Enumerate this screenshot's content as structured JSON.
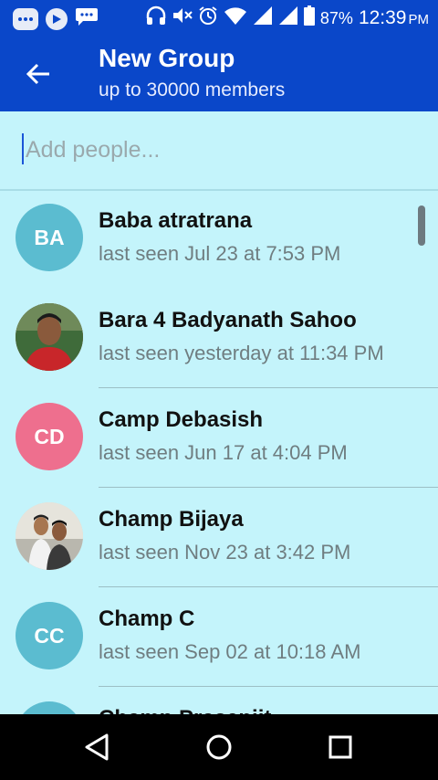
{
  "status_bar": {
    "battery_percent": "87%",
    "time": "12:39",
    "ampm": "PM",
    "icons": [
      "messages-icon",
      "play-icon",
      "chat-icon",
      "headphones-icon",
      "mute-icon",
      "alarm-icon",
      "wifi-icon",
      "signal-icon",
      "signal-icon",
      "battery-icon"
    ]
  },
  "app_bar": {
    "title": "New Group",
    "subtitle": "up to 30000 members",
    "back_icon": "arrow-back-icon"
  },
  "search": {
    "placeholder": "Add people...",
    "value": ""
  },
  "contacts": [
    {
      "initials": "BA",
      "name": "Baba atratrana",
      "status": "last seen Jul 23 at 7:53 PM",
      "avatar_color": "#5bbcd0",
      "photo": false
    },
    {
      "initials": "",
      "name": "Bara 4 Badyanath Sahoo",
      "status": "last seen yesterday at 11:34 PM",
      "avatar_color": "#b94a3a",
      "photo": true
    },
    {
      "initials": "CD",
      "name": "Camp Debasish",
      "status": "last seen Jun 17 at 4:04 PM",
      "avatar_color": "#ee6f8e",
      "photo": false
    },
    {
      "initials": "",
      "name": "Champ Bijaya",
      "status": "last seen Nov 23 at 3:42 PM",
      "avatar_color": "#d9d6cc",
      "photo": true
    },
    {
      "initials": "CC",
      "name": "Champ C",
      "status": "last seen Sep 02 at 10:18 AM",
      "avatar_color": "#5bbcd0",
      "photo": false
    },
    {
      "initials": "",
      "name": "Champ Prasenjit",
      "status": "",
      "avatar_color": "#5bbcd0",
      "photo": false
    }
  ],
  "colors": {
    "primary": "#0a47c9",
    "background": "#c4f4fb"
  },
  "nav": {
    "icons": [
      "back-triangle-icon",
      "home-circle-icon",
      "recents-square-icon"
    ]
  }
}
